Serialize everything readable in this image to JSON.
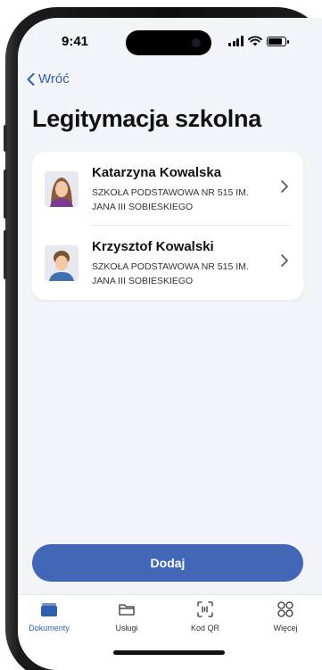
{
  "status_bar": {
    "time": "9:41"
  },
  "nav": {
    "back_label": "Wróć"
  },
  "page": {
    "title": "Legitymacja szkolna"
  },
  "students": [
    {
      "name": "Katarzyna Kowalska",
      "school": "SZKOŁA PODSTAWOWA NR 515 IM. JANA III SOBIESKIEGO"
    },
    {
      "name": "Krzysztof Kowalski",
      "school": "SZKOŁA PODSTAWOWA NR 515 IM. JANA III SOBIESKIEGO"
    }
  ],
  "actions": {
    "add_label": "Dodaj"
  },
  "tab_bar": {
    "items": [
      {
        "label": "Dokumenty",
        "icon": "wallet-icon",
        "active": true
      },
      {
        "label": "Usługi",
        "icon": "folder-icon",
        "active": false
      },
      {
        "label": "Kod QR",
        "icon": "qr-scan-icon",
        "active": false
      },
      {
        "label": "Więcej",
        "icon": "grid-icon",
        "active": false
      }
    ]
  },
  "colors": {
    "accent": "#4267b6",
    "link": "#2f5fb3",
    "background": "#f2f4f8"
  }
}
